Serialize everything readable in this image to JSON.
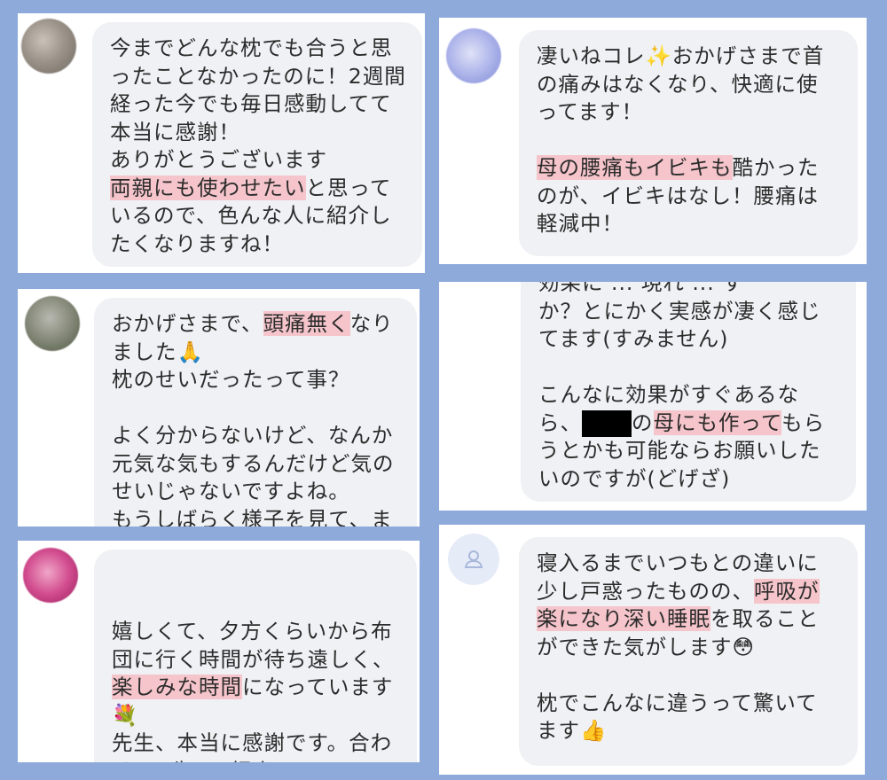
{
  "cards": {
    "c1": {
      "lines": [
        [
          "今までどんな枕でも合うと思"
        ],
        [
          "ったことなかったのに！2週間"
        ],
        [
          "経った今でも毎日感動してて"
        ],
        [
          "本当に感謝！"
        ],
        [
          "ありがとうございます"
        ],
        [
          "",
          "両親にも使わせたい",
          "と思って"
        ],
        [
          "いるので、色んな人に紹介し"
        ],
        [
          "たくなりますね！"
        ]
      ]
    },
    "c2": {
      "lines": [
        [
          "凄いねコレ✨おかげさまで首"
        ],
        [
          "の痛みはなくなり、快適に使"
        ],
        [
          "ってます！"
        ],
        [],
        [
          "",
          "母の腰痛もイビキも",
          "酷かった"
        ],
        [
          "のが、イビキはなし！腰痛は"
        ],
        [
          "軽減中！"
        ]
      ]
    },
    "c3": {
      "lines": [
        [
          "おかげさまで、",
          "頭痛無く",
          "なり"
        ],
        [
          "ました🙏"
        ],
        [
          "枕のせいだったって事？"
        ],
        [],
        [
          "よく分からないけど、なんか"
        ],
        [
          "元気な気もするんだけど気の"
        ],
        [
          "せいじゃないですよね。"
        ],
        [
          "もうしばらく様子を見て、ま"
        ]
      ]
    },
    "c4": {
      "lines": [
        [
          "効果に ... 現れ ... す"
        ],
        [
          "か？とにかく実感が凄く感じ"
        ],
        [
          "てます(すみません)"
        ],
        [],
        [
          "こんなに効果がすぐあるな"
        ],
        [
          "ら、",
          "[REDACTED]",
          "の",
          "母にも作って",
          "もら"
        ],
        [
          "うとかも可能ならお願いした"
        ],
        [
          "いのですが(どげざ)"
        ]
      ]
    },
    "c5": {
      "lines": [
        [],
        [],
        [
          "嬉しくて、夕方くらいから布"
        ],
        [
          "団に行く時間が待ち遠しく、"
        ],
        [
          "",
          "楽しみな時間",
          "になっています"
        ],
        [
          "💐"
        ],
        [
          "先生、本当に感謝です。合わ"
        ],
        [
          "せ ... 先 ... 紹介 ..."
        ]
      ]
    },
    "c6": {
      "lines": [
        [
          "寝入るまでいつもとの違いに"
        ],
        [
          "少し戸惑ったものの、",
          "呼吸が",
          ""
        ],
        [
          "",
          "楽になり深い睡眠",
          "を取ること"
        ],
        [
          "ができた気がします😳"
        ],
        [],
        [
          "枕でこんなに違うって驚いて"
        ],
        [
          "ます👍"
        ]
      ]
    }
  },
  "colors": {
    "background": "#8daadb",
    "bubble": "#eff1f4",
    "highlight": "#f5c5cb"
  },
  "icons": {
    "default_avatar": "person-outline-icon"
  }
}
